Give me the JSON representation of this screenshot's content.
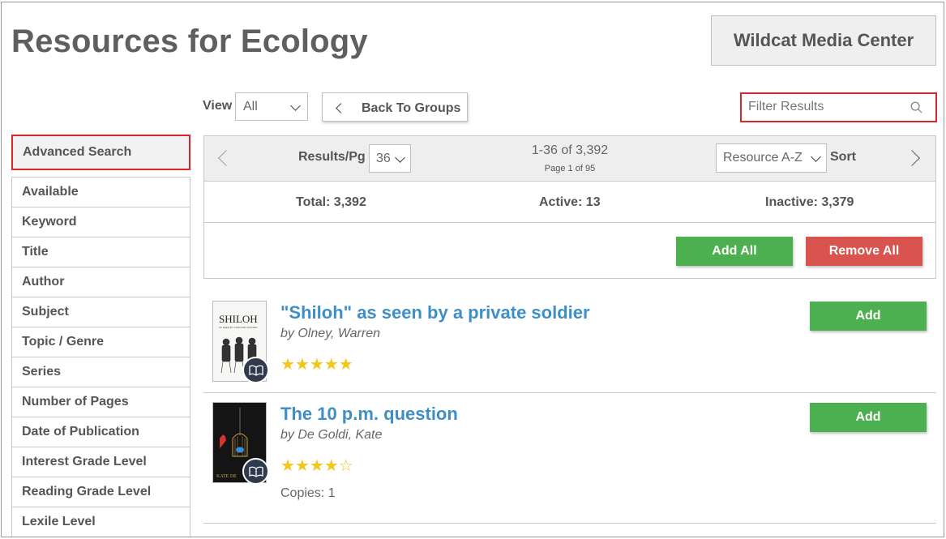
{
  "header": {
    "title": "Resources for Ecology",
    "media_center_label": "Wildcat Media Center"
  },
  "toolbar": {
    "view_label": "View",
    "view_value": "All",
    "back_label": "Back To Groups",
    "filter_placeholder": "Filter Results"
  },
  "sidebar": {
    "items": [
      {
        "label": "Advanced Search"
      },
      {
        "label": "Available"
      },
      {
        "label": "Keyword"
      },
      {
        "label": "Title"
      },
      {
        "label": "Author"
      },
      {
        "label": "Subject"
      },
      {
        "label": "Topic / Genre"
      },
      {
        "label": "Series"
      },
      {
        "label": "Number of Pages"
      },
      {
        "label": "Date of Publication"
      },
      {
        "label": "Interest Grade Level"
      },
      {
        "label": "Reading Grade Level"
      },
      {
        "label": "Lexile Level"
      }
    ]
  },
  "pager": {
    "results_per_page_label": "Results/Pg",
    "results_per_page_value": "36",
    "range": "1-36 of 3,392",
    "page_of": "Page 1 of 95",
    "sort_value": "Resource A-Z",
    "sort_label": "Sort"
  },
  "totals": {
    "total": "Total: 3,392",
    "active": "Active: 13",
    "inactive": "Inactive: 3,379"
  },
  "actions": {
    "add_all": "Add All",
    "remove_all": "Remove All"
  },
  "results": [
    {
      "title": "\"Shiloh\" as seen by a private soldier",
      "author": "by Olney, Warren",
      "rating": 5,
      "rating_max": 5,
      "stars_text": "★★★★★",
      "add_label": "Add",
      "cover_text": "SHILOH",
      "cover_sub": "AS SEEN BY A PRIVATE SOLDIER"
    },
    {
      "title": "The 10 p.m. question",
      "author": "by De Goldi, Kate",
      "rating": 4,
      "rating_max": 5,
      "stars_filled": "★★★★",
      "stars_empty": "☆",
      "copies": "Copies: 1",
      "add_label": "Add",
      "cover_text": "KATE DE"
    }
  ],
  "colors": {
    "accent_blue": "#3d8fc5",
    "add_green": "#4caf50",
    "remove_red": "#d9534f",
    "highlight_red": "#d9262b",
    "star_yellow": "#f5c518"
  },
  "icons": {
    "search": "search-icon",
    "back": "chevron-left-icon",
    "read": "open-book-icon"
  }
}
